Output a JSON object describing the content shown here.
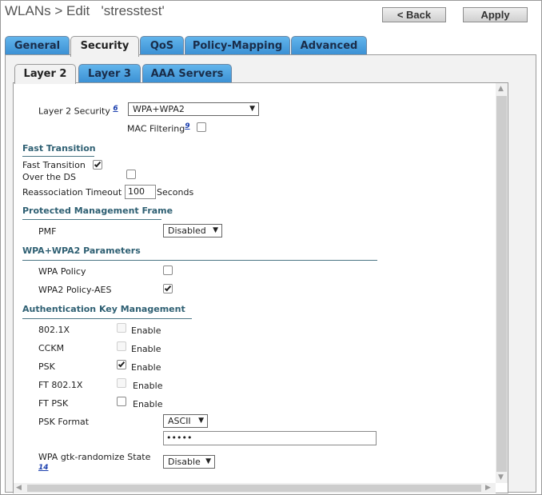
{
  "header": {
    "title": "WLANs > Edit   'stresstest'",
    "back_label": "< Back",
    "apply_label": "Apply"
  },
  "tabs": [
    "General",
    "Security",
    "QoS",
    "Policy-Mapping",
    "Advanced"
  ],
  "active_tab": "Security",
  "subtabs": [
    "Layer 2",
    "Layer 3",
    "AAA Servers"
  ],
  "active_subtab": "Layer 2",
  "layer2": {
    "security_label": "Layer 2 Security",
    "security_footnote": "6",
    "security_value": "WPA+WPA2",
    "mac_filtering_label": "MAC Filtering",
    "mac_filtering_footnote": "9",
    "mac_filtering_checked": false
  },
  "fast_transition": {
    "heading": "Fast Transition",
    "ft_label": "Fast Transition",
    "ft_checked": true,
    "over_ds_label": "Over the DS",
    "over_ds_checked": false,
    "reassoc_label": "Reassociation Timeout",
    "reassoc_value": "100",
    "reassoc_unit": "Seconds"
  },
  "pmf": {
    "heading": "Protected Management Frame",
    "label": "PMF",
    "value": "Disabled"
  },
  "wpa_params": {
    "heading": "WPA+WPA2 Parameters",
    "wpa_policy_label": "WPA Policy",
    "wpa_policy_checked": false,
    "wpa2_aes_label": "WPA2 Policy-AES",
    "wpa2_aes_checked": true
  },
  "akm": {
    "heading": "Authentication Key Management",
    "enable_label": "Enable",
    "rows": [
      {
        "label": "802.1X",
        "checked": false,
        "disabled": true
      },
      {
        "label": "CCKM",
        "checked": false,
        "disabled": true
      },
      {
        "label": "PSK",
        "checked": true,
        "disabled": false
      },
      {
        "label": "FT 802.1X",
        "checked": false,
        "disabled": true
      },
      {
        "label": "FT PSK",
        "checked": false,
        "disabled": false
      }
    ],
    "psk_format_label": "PSK Format",
    "psk_format_value": "ASCII",
    "psk_value": "•••••",
    "gtk_label": "WPA gtk-randomize State",
    "gtk_footnote": "14",
    "gtk_value": "Disable"
  },
  "icons": {
    "caret": "▼",
    "scroll_up": "▲",
    "scroll_down": "▼",
    "scroll_left": "◀",
    "scroll_right": "▶"
  },
  "colors": {
    "tab_blue": "#4aa3e3",
    "section_heading": "#2f6073",
    "link": "#1b3fae"
  }
}
